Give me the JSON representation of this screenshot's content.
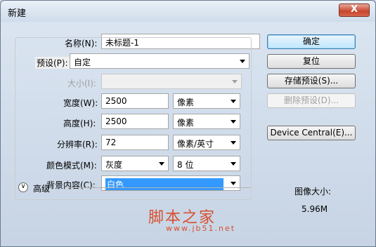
{
  "window": {
    "title": "新建",
    "close_label": "X"
  },
  "form": {
    "name_label": "名称(N):",
    "name_value": "未标题-1",
    "preset_label": "预设(P):",
    "preset_value": "自定",
    "size_label": "大小(I):",
    "size_value": "",
    "width_label": "宽度(W):",
    "width_value": "2500",
    "width_unit": "像素",
    "height_label": "高度(H):",
    "height_value": "2500",
    "height_unit": "像素",
    "resolution_label": "分辨率(R):",
    "resolution_value": "72",
    "resolution_unit": "像素/英寸",
    "color_mode_label": "颜色模式(M):",
    "color_mode_value": "灰度",
    "bit_depth_value": "8 位",
    "background_label": "背景内容(C):",
    "background_value": "白色",
    "advanced_label": "高级"
  },
  "buttons": {
    "ok": "确定",
    "reset": "复位",
    "save_preset": "存储预设(S)...",
    "delete_preset": "删除预设(D)...",
    "device_central": "Device Central(E)..."
  },
  "image_size": {
    "label": "图像大小:",
    "value": "5.96M"
  },
  "watermark": {
    "main": "脚本之家",
    "url": "www.jb51.net"
  }
}
